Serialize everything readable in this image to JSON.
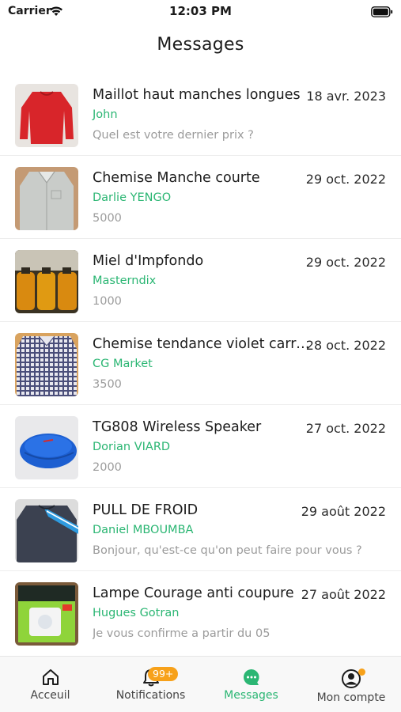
{
  "status_bar": {
    "carrier": "Carrier",
    "time": "12:03 PM"
  },
  "header": {
    "title": "Messages"
  },
  "conversations": [
    {
      "title": "Maillot haut manches longues",
      "sender": "John",
      "date": "18 avr. 2023",
      "preview": "Quel est votre dernier prix ?"
    },
    {
      "title": "Chemise Manche courte",
      "sender": "Darlie YENGO",
      "date": "29 oct. 2022",
      "preview": "5000"
    },
    {
      "title": "Miel d'Impfondo",
      "sender": "Masterndix",
      "date": "29 oct. 2022",
      "preview": "1000"
    },
    {
      "title": "Chemise tendance violet carreaux",
      "sender": "CG Market",
      "date": "28 oct. 2022",
      "preview": "3500"
    },
    {
      "title": "TG808 Wireless Speaker",
      "sender": "Dorian VIARD",
      "date": "27 oct. 2022",
      "preview": "2000"
    },
    {
      "title": "PULL DE FROID",
      "sender": "Daniel MBOUMBA",
      "date": "29 août 2022",
      "preview": "Bonjour, qu'est-ce qu'on peut faire pour vous ?"
    },
    {
      "title": "Lampe Courage anti coupure",
      "sender": "Hugues Gotran",
      "date": "27 août 2022",
      "preview": "Je vous confirme a partir du 05"
    }
  ],
  "tab_bar": {
    "tabs": [
      {
        "label": "Acceuil",
        "icon": "home-icon"
      },
      {
        "label": "Notifications",
        "icon": "bell-icon",
        "badge": "99+"
      },
      {
        "label": "Messages",
        "icon": "chat-bubble-icon",
        "active": true
      },
      {
        "label": "Mon compte",
        "icon": "account-icon"
      }
    ]
  },
  "colors": {
    "accent": "#2bb673",
    "badge": "#f7a11a",
    "muted": "#9b9b9b"
  }
}
